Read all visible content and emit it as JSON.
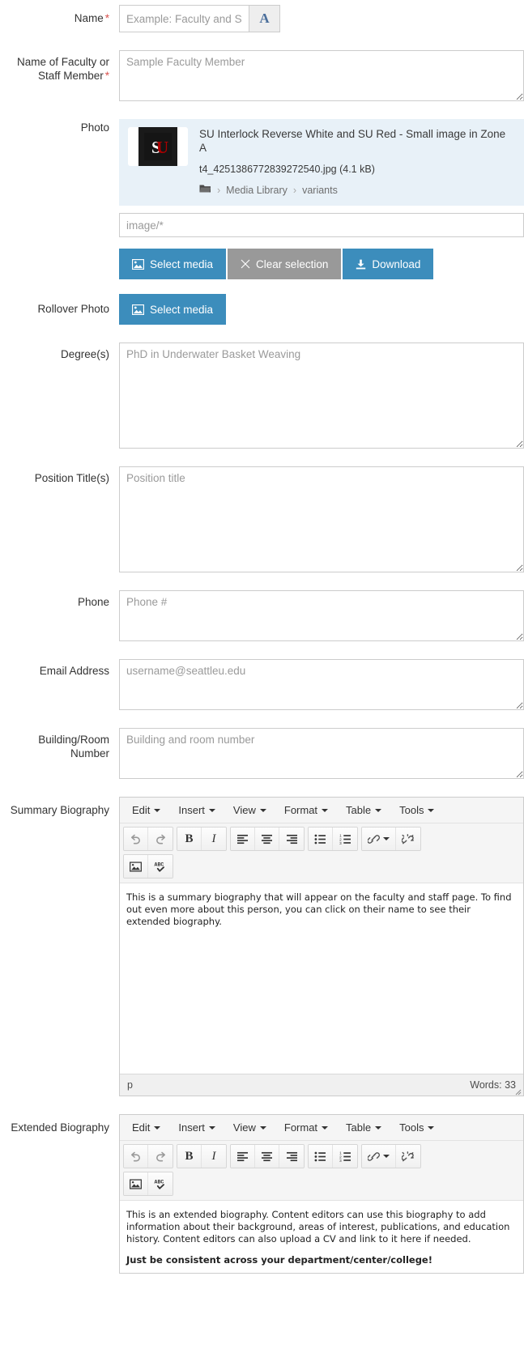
{
  "form": {
    "fields": {
      "name": {
        "label": "Name",
        "required": true,
        "placeholder": "Example: Faculty and Staff Profile",
        "value": "",
        "style_button_label": "A"
      },
      "faculty_name": {
        "label_line1": "Name of Faculty or",
        "label_line2": "Staff Member",
        "required": true,
        "placeholder": "Sample Faculty Member",
        "value": ""
      },
      "photo": {
        "label": "Photo",
        "media": {
          "title": "SU Interlock Reverse White and SU Red - Small image in Zone A",
          "filename": "t4_4251386772839272540.jpg (4.1 kB)",
          "breadcrumb": [
            "Media Library",
            "variants"
          ],
          "thumb_alt": "SU"
        },
        "mime_placeholder": "image/*",
        "mime_value": "",
        "buttons": [
          {
            "label": "Select media",
            "icon": "image-icon",
            "style": "primary"
          },
          {
            "label": "Clear selection",
            "icon": "close-icon",
            "style": "muted"
          },
          {
            "label": "Download",
            "icon": "download-icon",
            "style": "primary"
          }
        ]
      },
      "rollover_photo": {
        "label": "Rollover Photo",
        "button": {
          "label": "Select media",
          "icon": "image-icon",
          "style": "primary"
        }
      },
      "degrees": {
        "label": "Degree(s)",
        "placeholder": "PhD in Underwater Basket Weaving",
        "value": ""
      },
      "position_titles": {
        "label": "Position Title(s)",
        "placeholder": "Position title",
        "value": ""
      },
      "phone": {
        "label": "Phone",
        "placeholder": "Phone #",
        "value": ""
      },
      "email": {
        "label": "Email Address",
        "placeholder": "username@seattleu.edu",
        "value": ""
      },
      "building_room": {
        "label": "Building/Room Number",
        "placeholder": "Building and room number",
        "value": ""
      },
      "summary_biography": {
        "label": "Summary Biography",
        "editor": {
          "menu": [
            "Edit",
            "Insert",
            "View",
            "Format",
            "Table",
            "Tools"
          ],
          "toolbar_row1": [
            "undo-icon",
            "redo-icon",
            "bold-icon",
            "italic-icon",
            "align-left-icon",
            "align-center-icon",
            "align-right-icon",
            "bullet-list-icon",
            "numbered-list-icon",
            "link-icon",
            "unlink-icon"
          ],
          "toolbar_row2": [
            "image-icon",
            "spellcheck-icon"
          ],
          "content": [
            {
              "text": "This is a summary biography that will appear on the faculty and staff page. To find out even more about this person, you can click on their name to see their extended biography.",
              "bold": false
            }
          ],
          "status_path": "p",
          "status_words": "Words: 33"
        }
      },
      "extended_biography": {
        "label": "Extended Biography",
        "editor": {
          "menu": [
            "Edit",
            "Insert",
            "View",
            "Format",
            "Table",
            "Tools"
          ],
          "toolbar_row1": [
            "undo-icon",
            "redo-icon",
            "bold-icon",
            "italic-icon",
            "align-left-icon",
            "align-center-icon",
            "align-right-icon",
            "bullet-list-icon",
            "numbered-list-icon",
            "link-icon",
            "unlink-icon"
          ],
          "toolbar_row2": [
            "image-icon",
            "spellcheck-icon"
          ],
          "content": [
            {
              "text": "This is an extended biography. Content editors can use this biography to add information about their background, areas of interest, publications, and education history. Content editors can also upload a CV and link to it here if needed.",
              "bold": false
            },
            {
              "text": "Just be consistent across your department/center/college!",
              "bold": true
            }
          ]
        }
      }
    }
  },
  "colors": {
    "primary_button": "#3c8dbc",
    "muted_button": "#999999",
    "media_panel_bg": "#e8f1f8",
    "required_asterisk": "#d9534f",
    "style_button_text": "#4a6e9b",
    "border": "#cccccc"
  }
}
